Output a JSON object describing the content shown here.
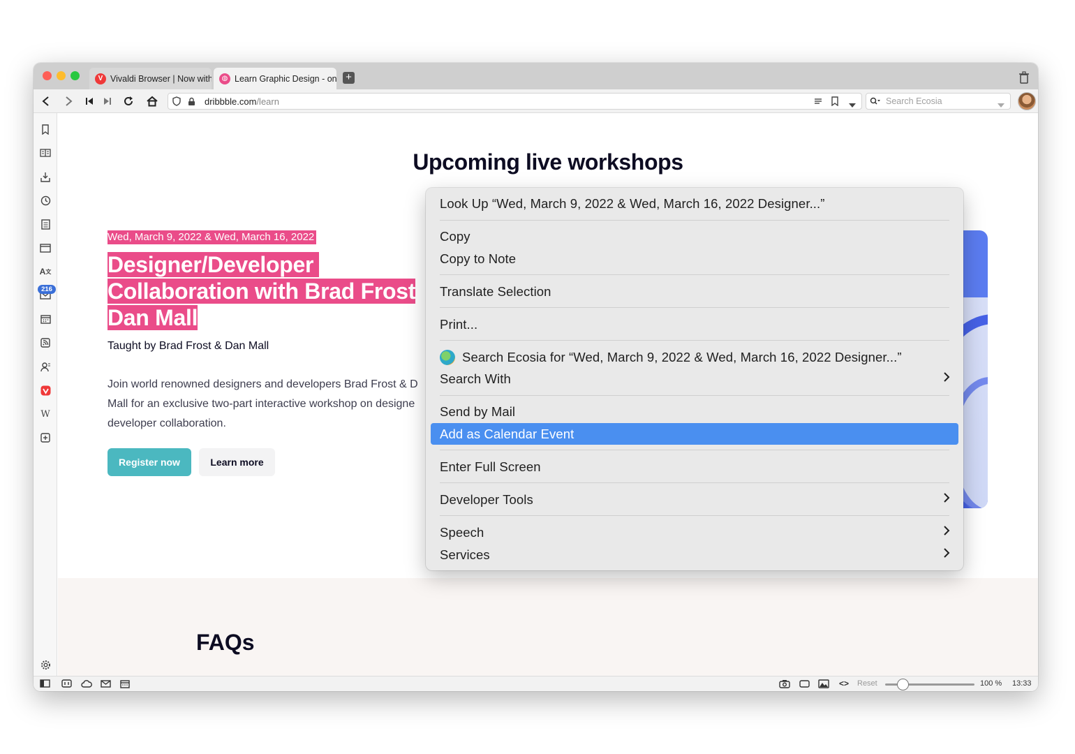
{
  "browser": {
    "tabs": [
      {
        "title": "Vivaldi Browser | Now with",
        "active": false
      },
      {
        "title": "Learn Graphic Design - on",
        "active": true
      }
    ],
    "url_domain": "dribbble.com",
    "url_path": "/learn",
    "search_placeholder": "Search Ecosia",
    "mail_badge": "216",
    "status": {
      "reset_label": "Reset",
      "zoom": "100 %",
      "time": "13:33",
      "zoom_fraction": 0.2
    }
  },
  "page": {
    "heading": "Upcoming live workshops",
    "date": "Wed, March 9, 2022 & Wed, March 16, 2022",
    "title_line1": "Designer/Developer",
    "title_line2": "Collaboration with Brad Frost",
    "title_line3": "Dan Mall",
    "taught_by": "Taught by Brad Frost & Dan Mall",
    "desc_line1": "Join world renowned designers and developers Brad Frost & D",
    "desc_line2": "Mall for an exclusive two-part interactive workshop on designe",
    "desc_line3": "developer collaboration.",
    "register_label": "Register now",
    "learn_more_label": "Learn more",
    "faq_heading": "FAQs"
  },
  "context_menu": {
    "lookup": "Look Up “Wed, March 9, 2022 & Wed, March 16, 2022 Designer...”",
    "copy": "Copy",
    "copy_to_note": "Copy to Note",
    "translate": "Translate Selection",
    "print": "Print...",
    "search_ecosia": "Search Ecosia for “Wed, March 9, 2022 & Wed, March 16, 2022 Designer...”",
    "search_with": "Search With",
    "send_by_mail": "Send by Mail",
    "add_calendar": "Add as Calendar Event",
    "full_screen": "Enter Full Screen",
    "dev_tools": "Developer Tools",
    "speech": "Speech",
    "services": "Services"
  },
  "colors": {
    "accent_pink": "#ea4c89",
    "menu_highlight": "#4a8ff0",
    "register_bg": "#4bb8c0",
    "hero_blue": "#5b7cf0"
  }
}
